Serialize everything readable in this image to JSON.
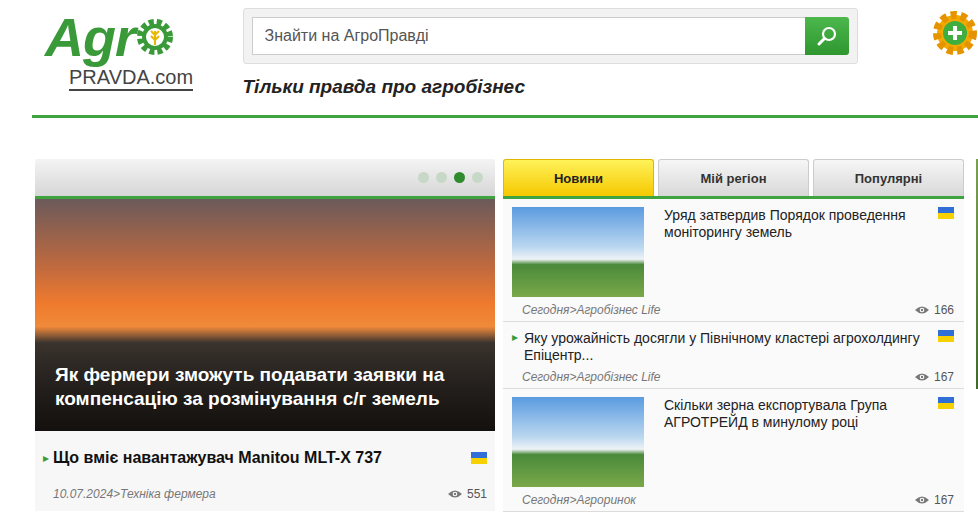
{
  "logo": {
    "main": "Agr",
    "sub": "PRAVDA.com"
  },
  "search": {
    "placeholder": "Знайти на АгроПравді"
  },
  "tagline": "Тільки правда про агробізнес",
  "slider": {
    "dots": [
      {
        "selected": false
      },
      {
        "selected": false
      },
      {
        "selected": true
      },
      {
        "selected": false
      }
    ],
    "caption": "Як фермери зможуть подавати заявки на компенсацію за розмінування с/г земель"
  },
  "featured": {
    "marker": "▸",
    "title": "Що вміє навантажувач Manitou MLT-X 737",
    "meta": "10.07.2024>Техніка фермера",
    "views": "551",
    "flag": true
  },
  "tabs": [
    {
      "label": "Новини",
      "selected": true
    },
    {
      "label": "Мій регіон",
      "selected": false
    },
    {
      "label": "Популярні",
      "selected": false
    }
  ],
  "news": [
    {
      "title": "Уряд затвердив Порядок проведення моніторингу земель",
      "image": true,
      "marker": "",
      "meta": "Сегодня>Агробізнес Life",
      "views": "166",
      "flag": true
    },
    {
      "title": "Яку урожайність досягли у Північному кластері агрохолдингу Епіцентр...",
      "image": false,
      "marker": "▸",
      "meta": "Сегодня>Агробізнес Life",
      "views": "167",
      "flag": true
    },
    {
      "title": "Скільки зерна експортувала Група АГРОТРЕЙД в минулому році",
      "image": true,
      "marker": "",
      "meta": "Сегодня>Агроринок",
      "views": "167",
      "flag": true
    }
  ]
}
